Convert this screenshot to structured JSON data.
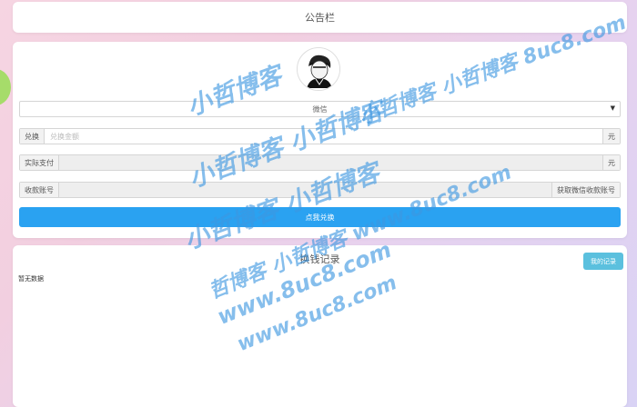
{
  "notice": {
    "title": "公告栏"
  },
  "form": {
    "method_selected": "微信",
    "amount": {
      "label": "兑换",
      "placeholder": "兑换金额",
      "unit": "元"
    },
    "pay": {
      "label": "实际支付",
      "unit": "元"
    },
    "account": {
      "label": "收款账号",
      "action": "获取微信收款账号"
    },
    "submit_label": "点我兑换"
  },
  "records": {
    "title": "换钱记录",
    "my_records_label": "我的记录",
    "empty_text": "暂无数据"
  },
  "watermarks": [
    "小哲博客",
    "小哲博客 小哲博客",
    "小哲博客 小哲博客",
    "小哲博客 小哲博客 8uc8.com",
    "哲博客 小哲博客 www.8uc8.com",
    "www.8uc8.com",
    "www.8uc8.com"
  ],
  "colors": {
    "accent": "#2aa2f1",
    "info": "#5bc0de",
    "watermark": "#3c96e1"
  }
}
